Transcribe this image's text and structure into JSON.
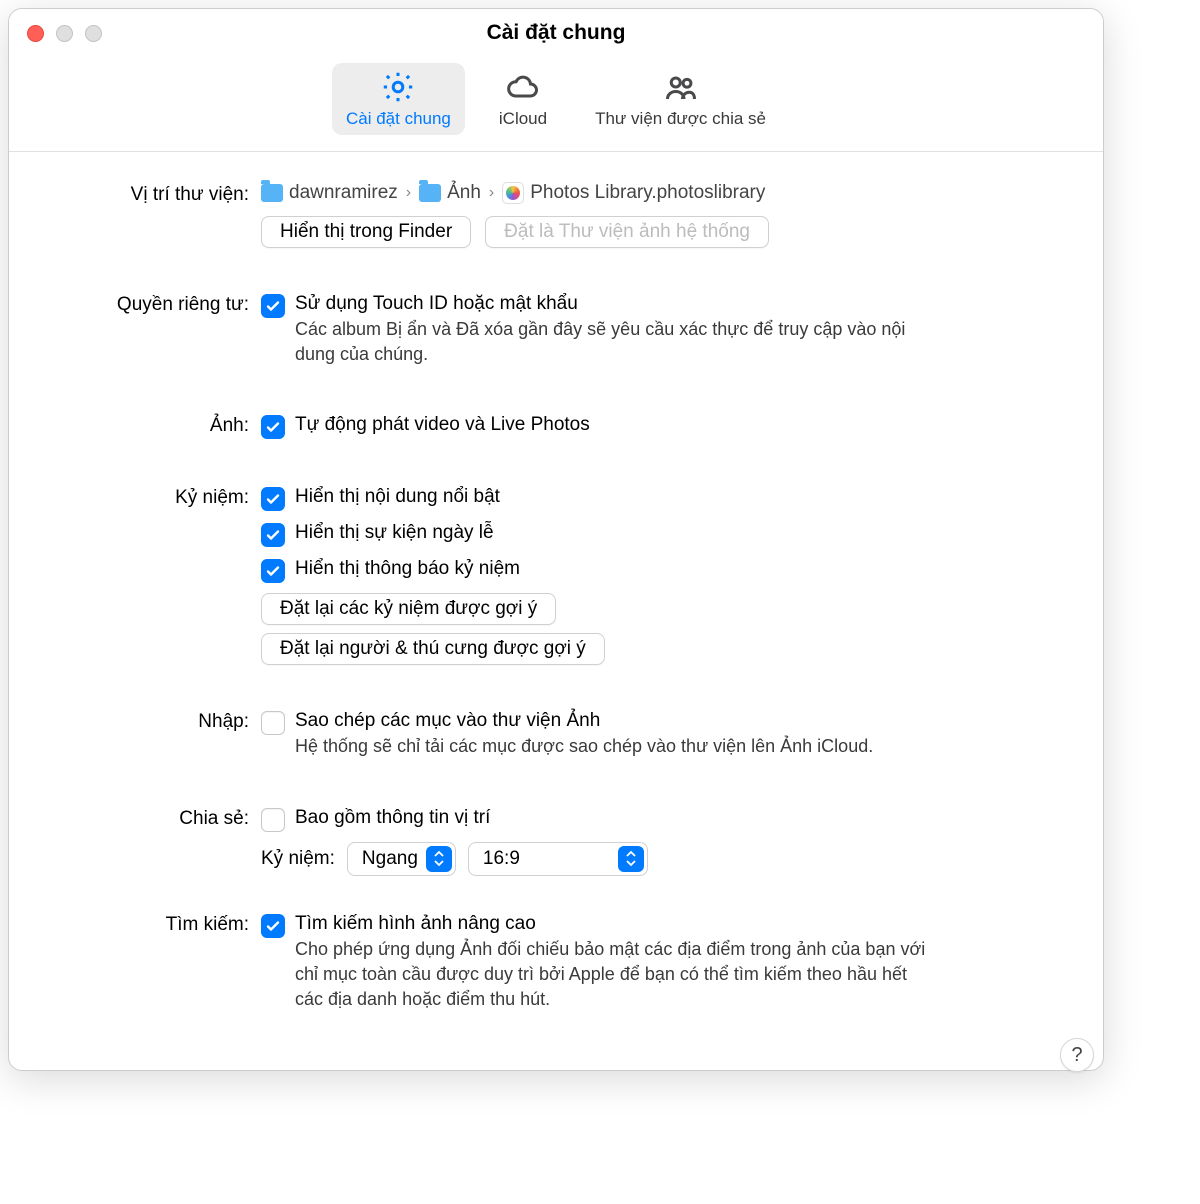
{
  "window": {
    "title": "Cài đặt chung"
  },
  "tabs": [
    {
      "label": "Cài đặt chung"
    },
    {
      "label": "iCloud"
    },
    {
      "label": "Thư viện được chia sẻ"
    }
  ],
  "library": {
    "label": "Vị trí thư viện:",
    "breadcrumb": [
      "dawnramirez",
      "Ảnh",
      "Photos Library.photoslibrary"
    ],
    "show_finder": "Hiển thị trong Finder",
    "set_system": "Đặt là Thư viện ảnh hệ thống"
  },
  "privacy": {
    "label": "Quyền riêng tư:",
    "check": "Sử dụng Touch ID hoặc mật khẩu",
    "desc": "Các album Bị ẩn và Đã xóa gần đây sẽ yêu cầu xác thực để truy cập vào nội dung của chúng."
  },
  "photos": {
    "label": "Ảnh:",
    "check": "Tự động phát video và Live Photos"
  },
  "memories": {
    "label": "Kỷ niệm:",
    "checks": [
      "Hiển thị nội dung nổi bật",
      "Hiển thị sự kiện ngày lễ",
      "Hiển thị thông báo kỷ niệm"
    ],
    "reset_memories": "Đặt lại các kỷ niệm được gợi ý",
    "reset_people": "Đặt lại người & thú cưng được gợi ý"
  },
  "import": {
    "label": "Nhập:",
    "check": "Sao chép các mục vào thư viện Ảnh",
    "desc": "Hệ thống sẽ chỉ tải các mục được sao chép vào thư viện lên Ảnh iCloud."
  },
  "sharing": {
    "label": "Chia sẻ:",
    "check": "Bao gồm thông tin vị trí",
    "sublabel": "Kỷ niệm:",
    "orientation": "Ngang",
    "aspect": "16:9"
  },
  "search": {
    "label": "Tìm kiếm:",
    "check": "Tìm kiếm hình ảnh nâng cao",
    "desc": "Cho phép ứng dụng Ảnh đối chiếu bảo mật các địa điểm trong ảnh của bạn với chỉ mục toàn cầu được duy trì bởi Apple để bạn có thể tìm kiếm theo hầu hết các địa danh hoặc điểm thu hút."
  },
  "help": "?"
}
